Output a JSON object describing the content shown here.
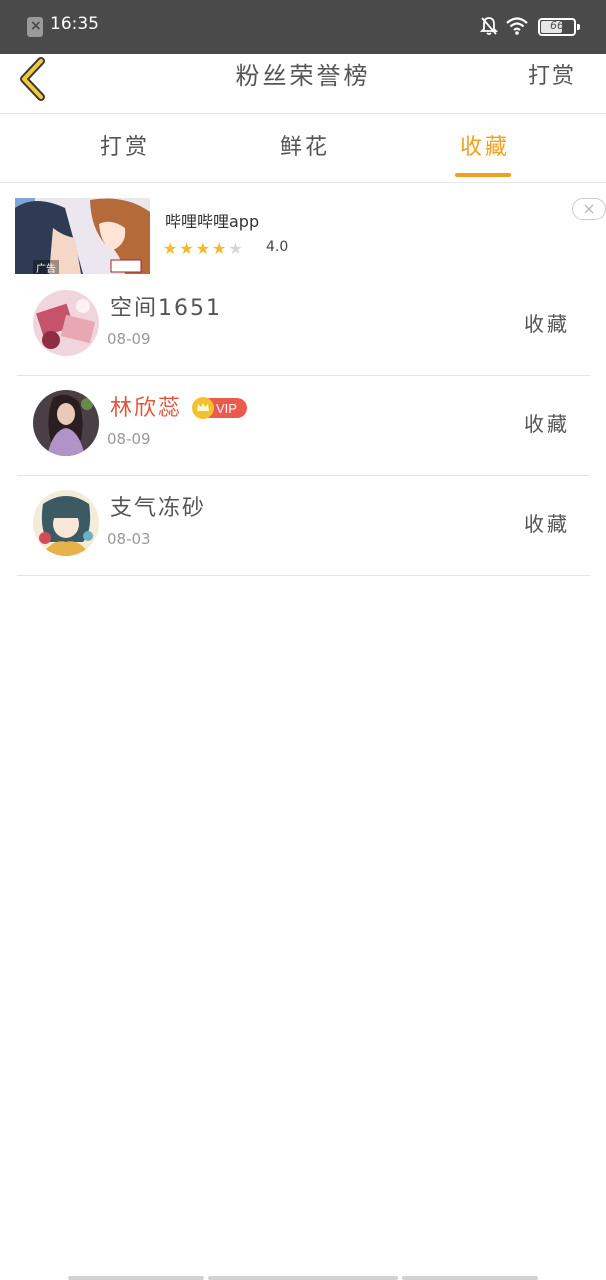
{
  "status_bar": {
    "time": "16:35",
    "battery": "66",
    "battery_level": 0.66,
    "icons": [
      "sim-error-icon",
      "bell-off-icon",
      "wifi-icon",
      "battery-icon"
    ]
  },
  "header": {
    "title": "粉丝荣誉榜",
    "action_label": "打赏",
    "back_icon": "chevron-left-icon",
    "accent_color": "#f0a020"
  },
  "tabs": [
    {
      "label": "打赏",
      "active": false
    },
    {
      "label": "鲜花",
      "active": false
    },
    {
      "label": "收藏",
      "active": true
    }
  ],
  "ad": {
    "tag": "广告",
    "title": "哔哩哔哩app",
    "rating": "4.0",
    "stars_filled": 4,
    "stars_total": 5,
    "close_icon": "close-icon"
  },
  "fans": [
    {
      "name": "空间1651",
      "date": "08-09",
      "action": "收藏",
      "vip": false
    },
    {
      "name": "林欣蕊",
      "date": "08-09",
      "action": "收藏",
      "vip": true,
      "vip_label": "VIP"
    },
    {
      "name": "支气冻砂",
      "date": "08-03",
      "action": "收藏",
      "vip": false
    }
  ]
}
